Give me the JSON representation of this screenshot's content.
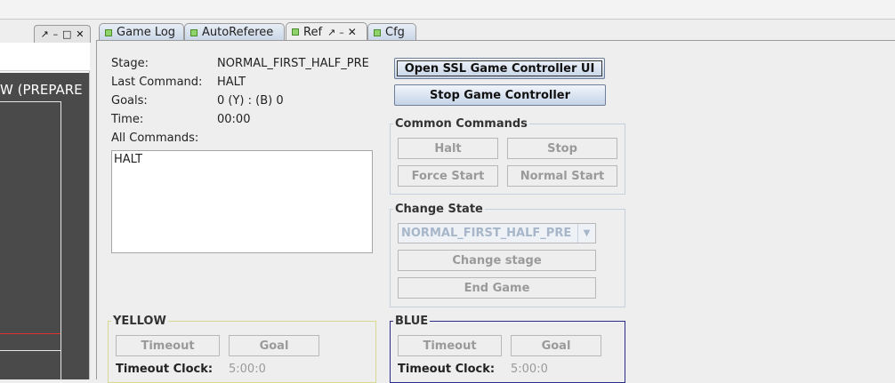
{
  "left_dock": {
    "field_text": "W (PREPARE"
  },
  "tabs": [
    {
      "label": "Game Log"
    },
    {
      "label": "AutoReferee"
    },
    {
      "label": "Ref"
    },
    {
      "label": "Cfg"
    }
  ],
  "status": {
    "stage_label": "Stage:",
    "stage_value": "NORMAL_FIRST_HALF_PRE",
    "last_command_label": "Last Command:",
    "last_command_value": "HALT",
    "goals_label": "Goals:",
    "goals_value": "0 (Y) : (B) 0",
    "time_label": "Time:",
    "time_value": "00:00",
    "all_commands_label": "All Commands:",
    "all_commands_text": "HALT"
  },
  "controller": {
    "open_ui_label": "Open SSL Game Controller UI",
    "stop_label": "Stop Game Controller"
  },
  "common_commands": {
    "title": "Common Commands",
    "halt": "Halt",
    "stop": "Stop",
    "force_start": "Force Start",
    "normal_start": "Normal Start"
  },
  "change_state": {
    "title": "Change State",
    "selected_stage": "NORMAL_FIRST_HALF_PRE",
    "change_stage": "Change stage",
    "end_game": "End Game"
  },
  "yellow": {
    "title": "YELLOW",
    "timeout": "Timeout",
    "goal": "Goal",
    "timeout_clock_label": "Timeout Clock:",
    "timeout_clock_value": "5:00:0",
    "border_color": "#d8d88e"
  },
  "blue": {
    "title": "BLUE",
    "timeout": "Timeout",
    "goal": "Goal",
    "timeout_clock_label": "Timeout Clock:",
    "timeout_clock_value": "5:00:0",
    "border_color": "#2b2b8a"
  },
  "icons": {
    "tab_indicator": "green-square-icon",
    "pin": "pin-icon",
    "minimize": "minimize-icon",
    "maximize": "maximize-icon",
    "close": "close-icon",
    "dropdown": "chevron-down-icon"
  }
}
